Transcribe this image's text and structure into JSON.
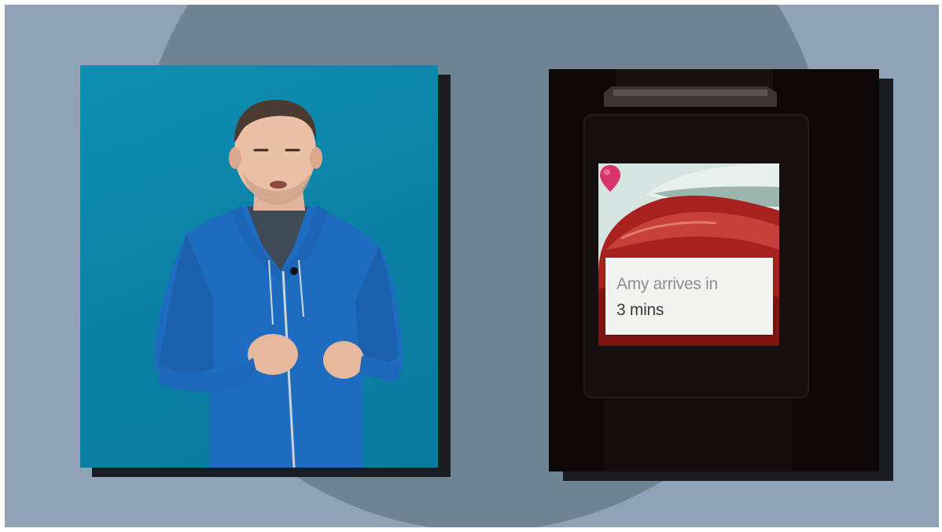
{
  "scene": {
    "background_color": "#8fa3b5",
    "circle_color": "#6f8493"
  },
  "presenter_panel": {
    "background_color": "#0a84a8",
    "hoodie_color": "#1f6fc4"
  },
  "watch": {
    "notification": {
      "line1": "Amy arrives in",
      "line2": "3 mins",
      "icon": "map-pin-icon",
      "accent_color": "#d9336b"
    }
  }
}
